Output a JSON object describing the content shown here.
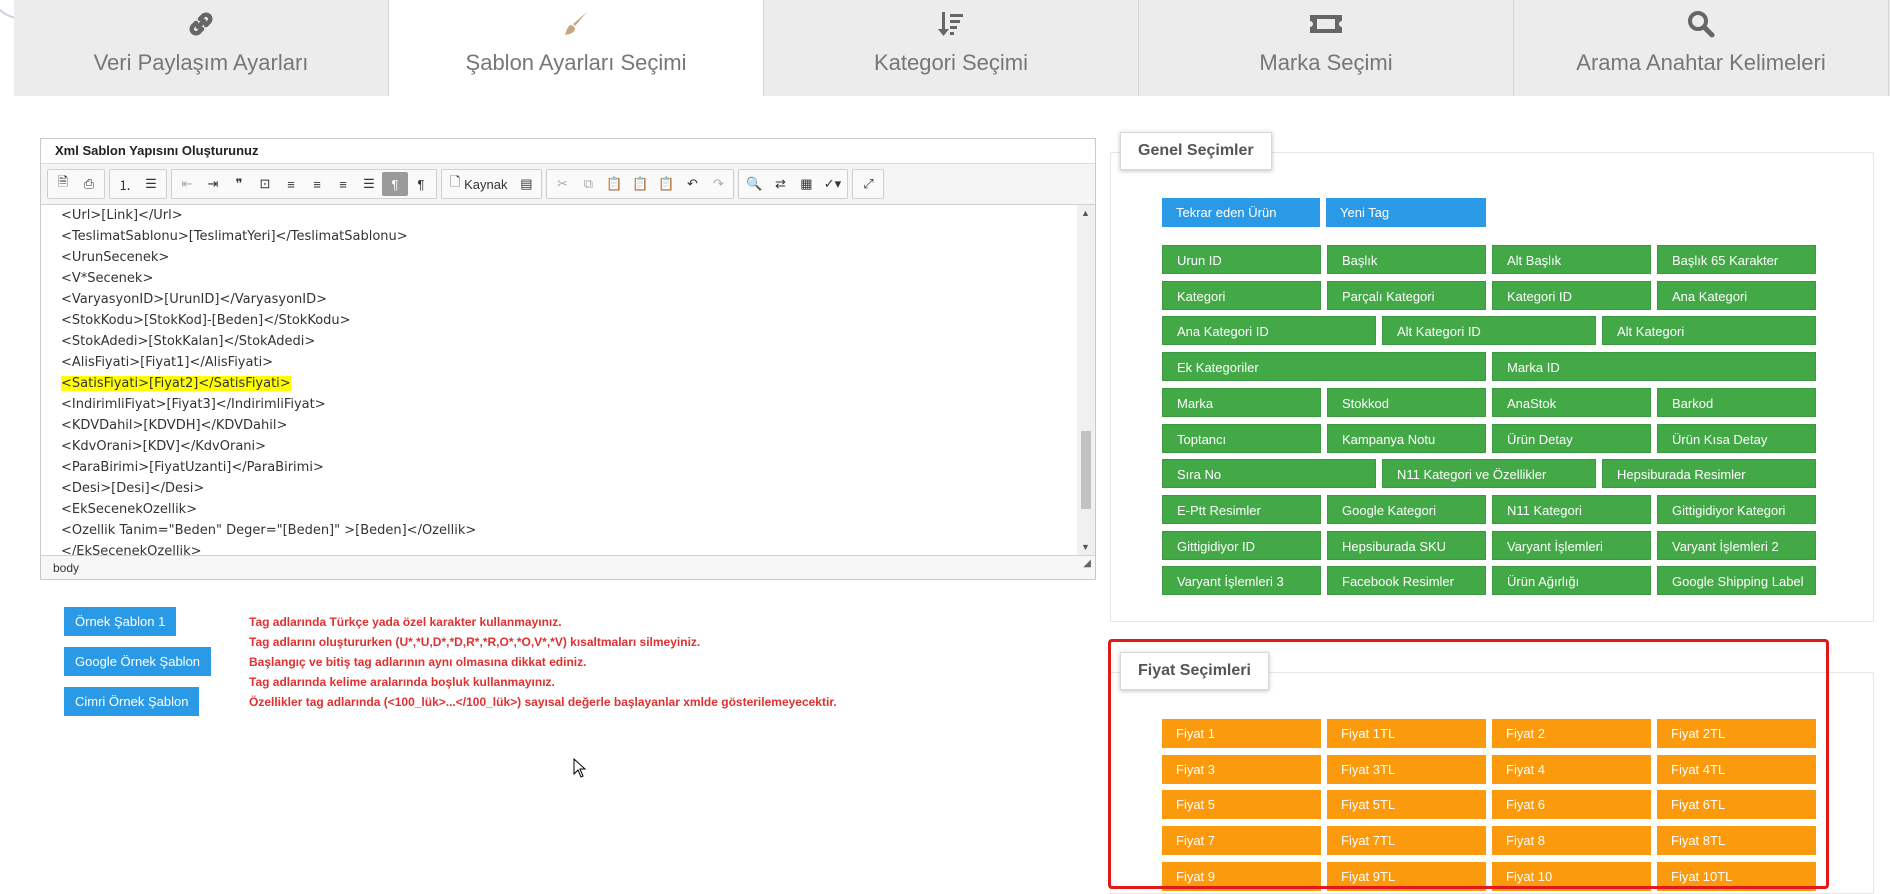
{
  "tabs": [
    {
      "label": "Veri Paylaşım Ayarları",
      "icon": "link-icon",
      "active": false
    },
    {
      "label": "Şablon Ayarları Seçimi",
      "icon": "paintbrush-icon",
      "active": true
    },
    {
      "label": "Kategori Seçimi",
      "icon": "sort-icon",
      "active": false
    },
    {
      "label": "Marka Seçimi",
      "icon": "ticket-icon",
      "active": false
    },
    {
      "label": "Arama Anahtar Kelimeleri",
      "icon": "search-icon",
      "active": false
    }
  ],
  "editor": {
    "title": "Xml Sablon Yapısını Oluşturunuz",
    "source_label": "Kaynak",
    "status": "body",
    "lines": [
      "<Url>[Link]</Url>",
      "<TeslimatSablonu>[TeslimatYeri]</TeslimatSablonu>",
      "<UrunSecenek>",
      "<V*Secenek>",
      "<VaryasyonID>[UrunID]</VaryasyonID>",
      "<StokKodu>[StokKod]-[Beden]</StokKodu>",
      "<StokAdedi>[StokKalan]</StokAdedi>",
      "<AlisFiyati>[Fiyat1]</AlisFiyati>",
      "<SatisFiyati>[Fiyat2]</SatisFiyati>",
      "<IndirimliFiyat>[Fiyat3]</IndirimliFiyat>",
      "<KDVDahil>[KDVDH]</KDVDahil>",
      "<KdvOrani>[KDV]</KdvOrani>",
      "<ParaBirimi>[FiyatUzanti]</ParaBirimi>",
      "<Desi>[Desi]</Desi>",
      "<EkSecenekOzellik>",
      "<Ozellik Tanim=\"Beden\" Deger=\"[Beden]\" >[Beden]</Ozellik>",
      "</EkSecenekOzellik>"
    ],
    "highlighted_line": "<SatisFiyati>[Fiyat2]</SatisFiyati>"
  },
  "sample_buttons": [
    "Örnek Şablon 1",
    "Google Örnek Şablon",
    "Cimri Örnek Şablon"
  ],
  "warnings": [
    "Tag adlarında Türkçe yada özel karakter kullanmayınız.",
    "Tag adlarını oluştururken (U*,*U,D*,*D,R*,*R,O*,*O,V*,*V) kısaltmaları silmeyiniz.",
    "Başlangıç ve bitiş tag adlarının aynı olmasına dikkat ediniz.",
    "Tag adlarında kelime aralarında boşluk kullanmayınız.",
    "Özellikler tag adlarında (<100_lük>...</100_lük>) sayısal değerle başlayanlar xmlde gösterilemeyecektir."
  ],
  "general": {
    "title": "Genel Seçimler",
    "top_buttons": [
      "Tekrar eden Ürün",
      "Yeni Tag"
    ],
    "rows": [
      [
        "Urun ID",
        "Başlık",
        "Alt Başlık",
        "Başlık 65 Karakter"
      ],
      [
        "Kategori",
        "Parçalı Kategori",
        "Kategori ID",
        "Ana Kategori"
      ],
      [
        "Ana Kategori ID",
        "Alt Kategori ID",
        "Alt Kategori"
      ],
      [
        "Ek Kategoriler",
        "Marka ID"
      ],
      [
        "Marka",
        "Stokkod",
        "AnaStok",
        "Barkod"
      ],
      [
        "Toptancı",
        "Kampanya Notu",
        "Ürün Detay",
        "Ürün Kısa Detay"
      ],
      [
        "Sıra No",
        "N11 Kategori ve Özellikler",
        "Hepsiburada Resimler"
      ],
      [
        "E-Ptt Resimler",
        "Google Kategori",
        "N11 Kategori",
        "Gittigidiyor Kategori"
      ],
      [
        "Gittigidiyor ID",
        "Hepsiburada SKU",
        "Varyant İşlemleri",
        "Varyant İşlemleri 2"
      ],
      [
        "Varyant İşlemleri 3",
        "Facebook Resimler",
        "Ürün Ağırlığı",
        "Google Shipping Label"
      ]
    ]
  },
  "price": {
    "title": "Fiyat Seçimleri",
    "rows": [
      [
        "Fiyat 1",
        "Fiyat 1TL",
        "Fiyat 2",
        "Fiyat 2TL"
      ],
      [
        "Fiyat 3",
        "Fiyat 3TL",
        "Fiyat 4",
        "Fiyat 4TL"
      ],
      [
        "Fiyat 5",
        "Fiyat 5TL",
        "Fiyat 6",
        "Fiyat 6TL"
      ],
      [
        "Fiyat 7",
        "Fiyat 7TL",
        "Fiyat 8",
        "Fiyat 8TL"
      ],
      [
        "Fiyat 9",
        "Fiyat 9TL",
        "Fiyat 10",
        "Fiyat 10TL"
      ]
    ]
  },
  "colors": {
    "blue": "#2a9ae6",
    "green": "#43a947",
    "orange": "#fb9a0c",
    "warning_red": "#e03030",
    "highlight_frame": "#e11919"
  }
}
